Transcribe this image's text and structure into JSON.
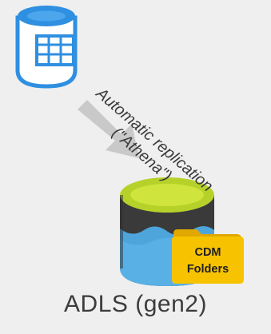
{
  "arrow": {
    "label_line1": "Automatic replication",
    "label_line2": "(\"Athena\")"
  },
  "folder_badge": {
    "line1": "CDM",
    "line2": "Folders"
  },
  "storage": {
    "caption": "ADLS (gen2)"
  },
  "colors": {
    "background": "#efefef",
    "source_db_blue": "#2f8fe0",
    "arrow_gray": "#c8c8c8",
    "lake_top_green": "#b6d22a",
    "lake_body_dark": "#3a3a3a",
    "lake_water_blue": "#4ea5dc",
    "folder_yellow": "#f7c300"
  }
}
